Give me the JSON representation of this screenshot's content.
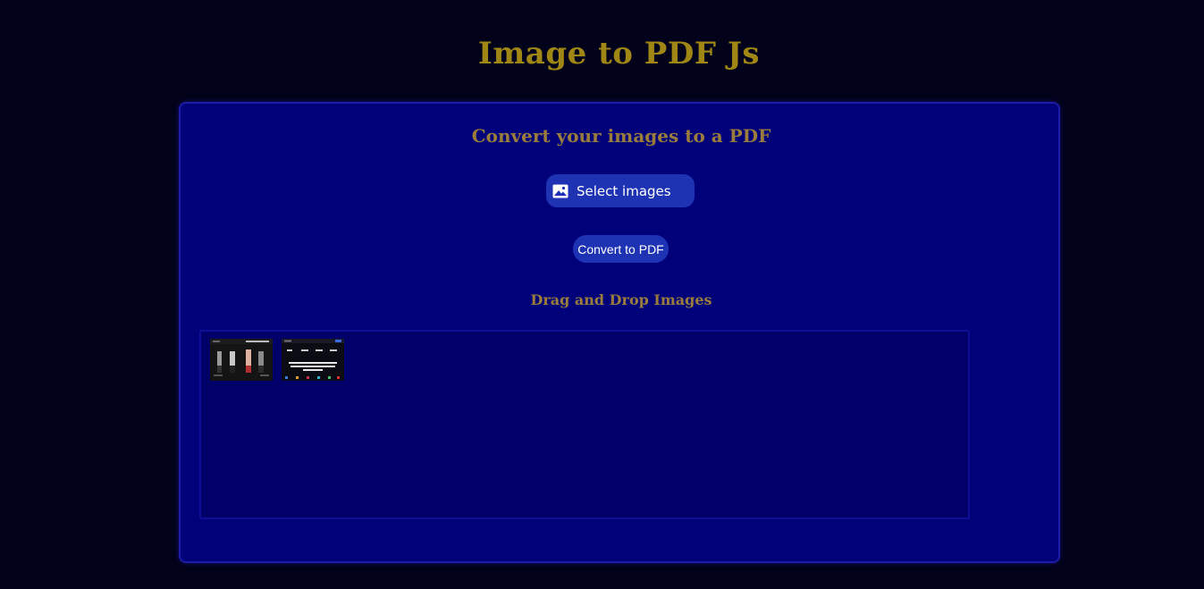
{
  "header": {
    "title": "Image to PDF Js"
  },
  "card": {
    "subtitle": "Convert your images to a PDF",
    "select_button": {
      "label": "Select images",
      "icon": "image-icon"
    },
    "convert_button": {
      "label": "Convert to PDF"
    },
    "drag_drop_title": "Drag and Drop Images",
    "drop_zone": {
      "thumbnails": [
        {
          "name": "image-thumbnail-1"
        },
        {
          "name": "image-thumbnail-2"
        }
      ]
    }
  },
  "colors": {
    "background": "#02021a",
    "card": "#01017a",
    "title_gold": "#a08614",
    "subtitle_gold": "#9a7c3c",
    "button_blue": "#1e32b4"
  }
}
